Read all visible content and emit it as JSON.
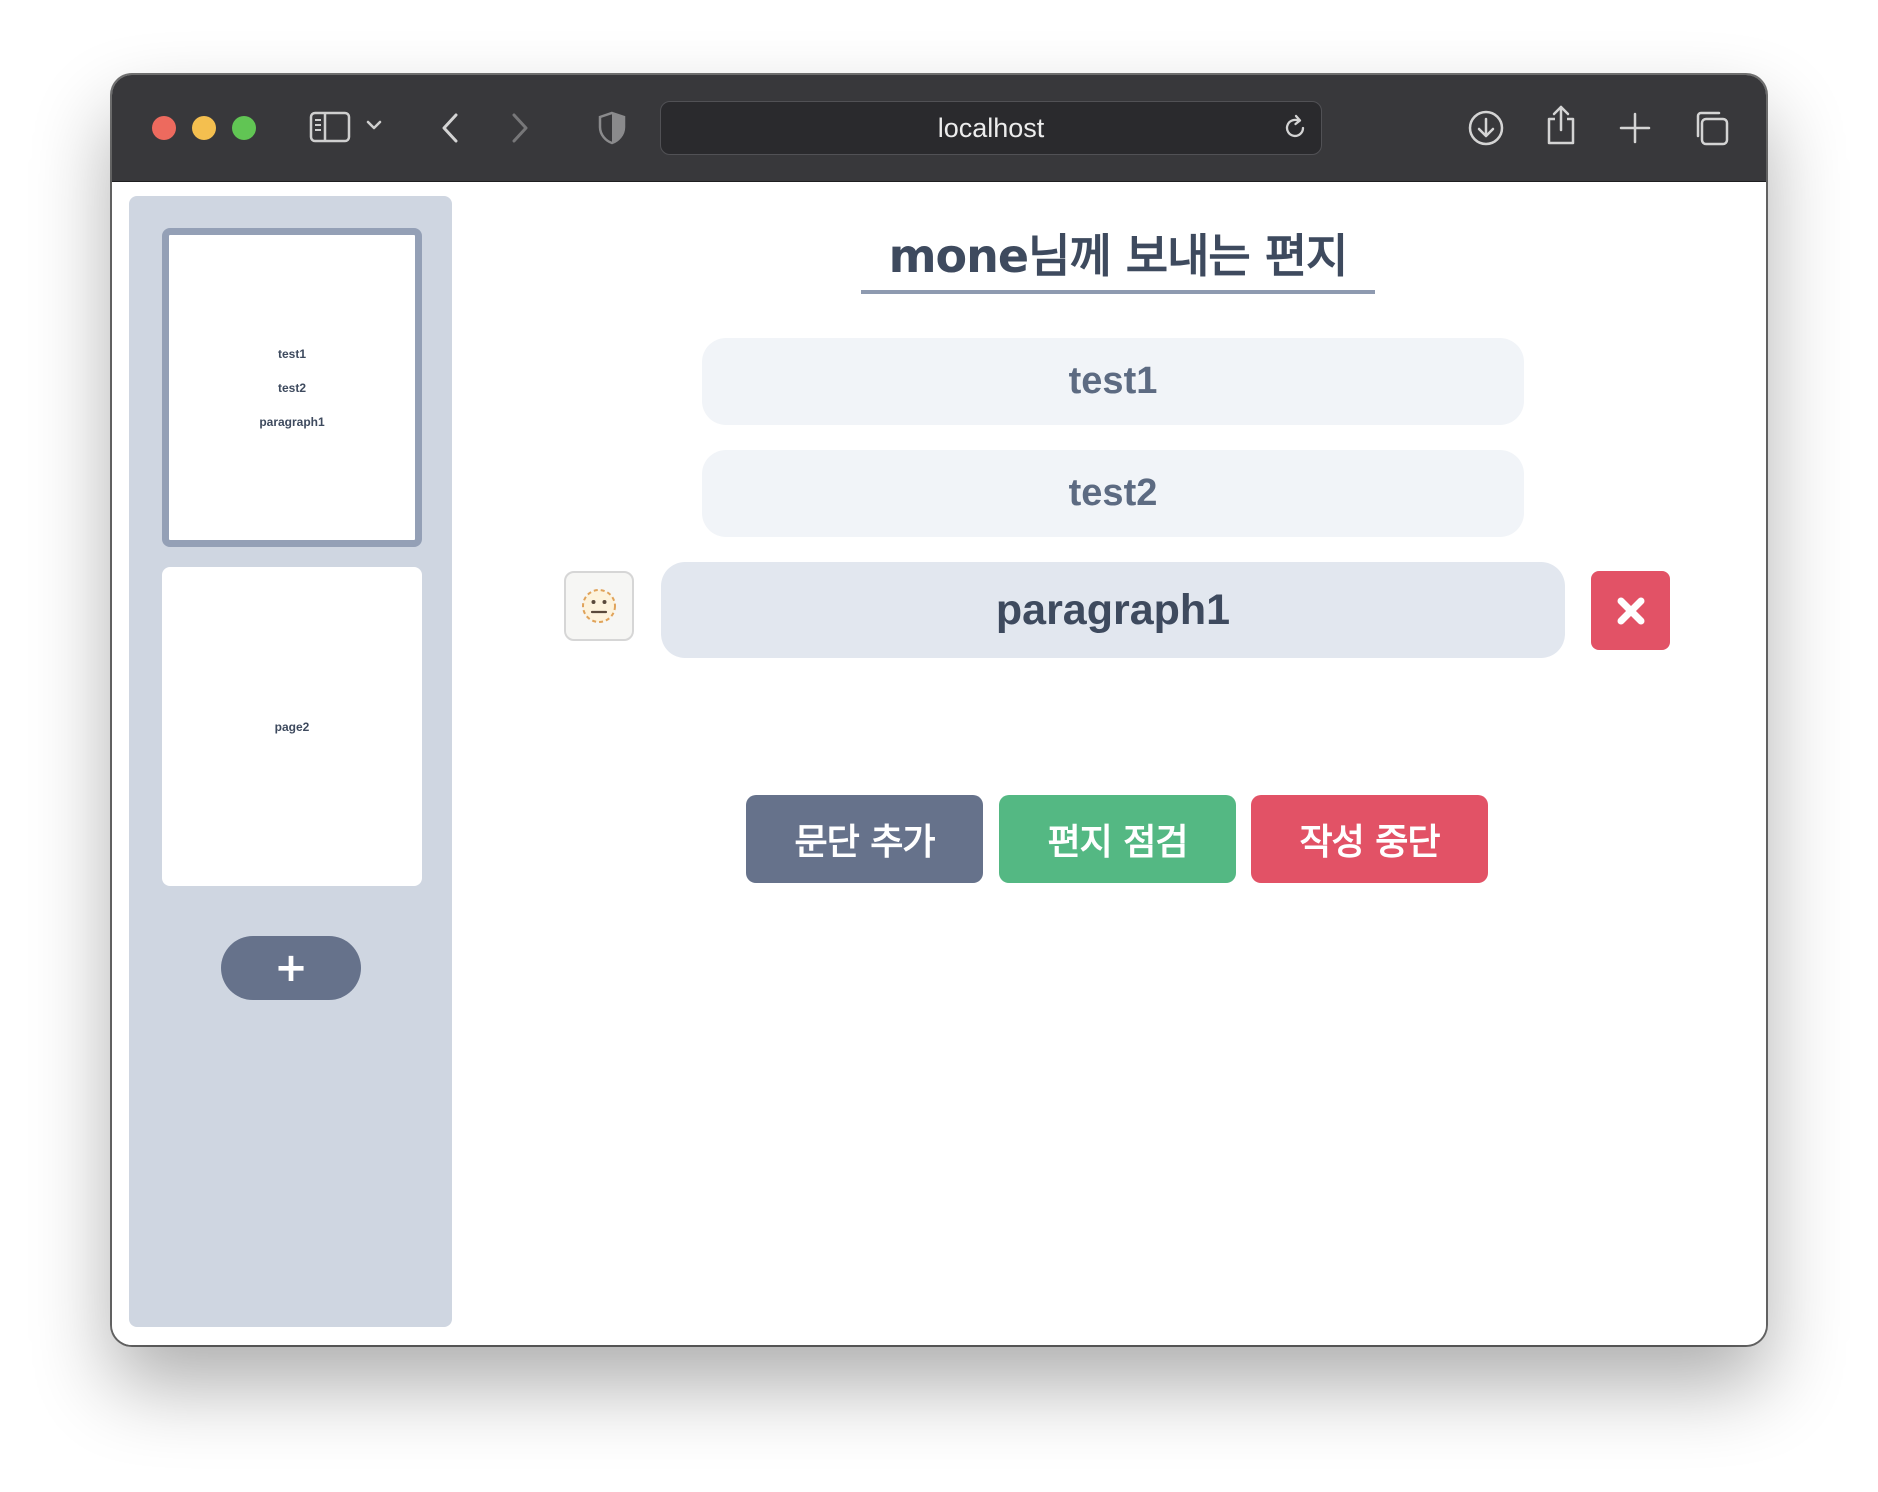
{
  "browser": {
    "url": "localhost"
  },
  "sidebar": {
    "pages": [
      {
        "lines": [
          "test1",
          "test2",
          "paragraph1"
        ],
        "active": true
      },
      {
        "lines": [
          "page2"
        ],
        "active": false
      }
    ],
    "add_page_label": "+"
  },
  "letter": {
    "title": "mone님께 보내는 편지",
    "paragraphs": [
      "test1",
      "test2",
      "paragraph1"
    ],
    "emoji_icon": "neutral-face-icon",
    "delete_icon": "close-x-icon"
  },
  "actions": {
    "add_paragraph": "문단 추가",
    "check_letter": "편지 점검",
    "stop_writing": "작성 중단"
  },
  "colors": {
    "primary_gray": "#66728b",
    "success_green": "#54b883",
    "danger_red": "#e25266",
    "sidebar_bg": "#cfd6e1",
    "title_text": "#3e4a5e"
  }
}
